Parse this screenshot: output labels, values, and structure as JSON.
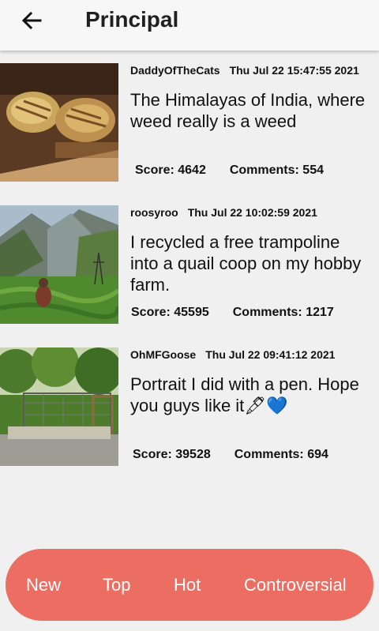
{
  "header": {
    "title": "Principal",
    "back_icon": "arrow-left-icon"
  },
  "posts": [
    {
      "author": "DaddyOfTheCats",
      "date": "Thu Jul 22 15:47:55 2021",
      "title": "The Himalayas of India, where weed really is a weed",
      "score": "Score: 4642",
      "comments": "Comments: 554"
    },
    {
      "author": "roosyroo",
      "date": "Thu Jul 22 10:02:59 2021",
      "title": "I recycled a free trampoline into a quail coop on my hobby farm.",
      "score": "Score: 45595",
      "comments": "Comments: 1217"
    },
    {
      "author": "OhMFGoose",
      "date": "Thu Jul 22 09:41:12 2021",
      "title": "Portrait I did with a pen. Hope you guys like it",
      "title_emoji_pen": "🖋",
      "title_emoji_heart": "💙",
      "score": "Score: 39528",
      "comments": "Comments: 694"
    }
  ],
  "tabs": {
    "new": "New",
    "top": "Top",
    "hot": "Hot",
    "controversial": "Controversial"
  },
  "colors": {
    "accent": "#ec6e63",
    "background": "#f0f0f0",
    "appbar": "#f7f7f7"
  }
}
